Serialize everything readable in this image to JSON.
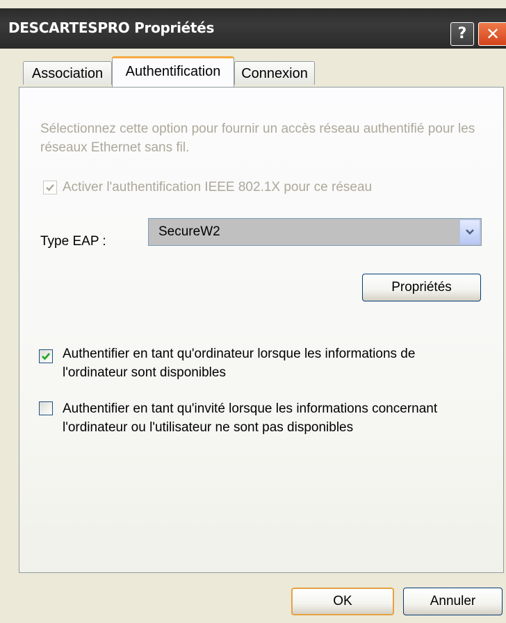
{
  "window": {
    "title": "DESCARTESPRO Propriétés",
    "help_label": "?",
    "close_label": "✕"
  },
  "tabs": [
    {
      "label": "Association",
      "active": false
    },
    {
      "label": "Authentification",
      "active": true
    },
    {
      "label": "Connexion",
      "active": false
    }
  ],
  "panel": {
    "hint_text": "Sélectionnez cette option pour fournir un accès réseau authentifié pour les réseaux Ethernet sans fil.",
    "ieee_checkbox": {
      "label": "Activer l'authentification IEEE 802.1X pour ce réseau",
      "checked": true,
      "enabled": false
    },
    "eap_type": {
      "label": "Type EAP :",
      "value": "SecureW2"
    },
    "properties_button": "Propriétés",
    "computer_auth_checkbox": {
      "label_line1": "Authentifier en tant qu'ordinateur lorsque les informations de",
      "label_line2": "l'ordinateur sont disponibles",
      "checked": true
    },
    "guest_auth_checkbox": {
      "label_line1": "Authentifier en tant qu'invité lorsque les informations concernant",
      "label_line2": "l'ordinateur ou l'utilisateur ne sont pas disponibles",
      "checked": false
    }
  },
  "footer": {
    "ok_label": "OK",
    "cancel_label": "Annuler"
  }
}
